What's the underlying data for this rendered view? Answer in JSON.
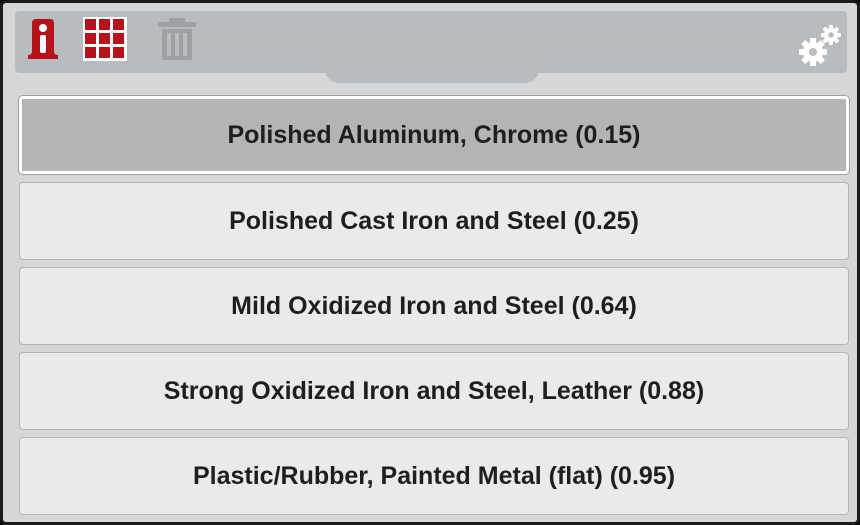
{
  "toolbar": {
    "icons": [
      "info-icon",
      "grid-icon",
      "trash-icon",
      "gear-icon"
    ],
    "colors": {
      "accent": "#b5121b",
      "disabled": "#9ea1a4",
      "gear": "#ffffff"
    }
  },
  "emissivity_list": {
    "selected_index": 0,
    "items": [
      {
        "label": "Polished Aluminum, Chrome (0.15)"
      },
      {
        "label": "Polished Cast Iron and Steel (0.25)"
      },
      {
        "label": "Mild Oxidized Iron and Steel (0.64)"
      },
      {
        "label": "Strong Oxidized Iron and Steel, Leather (0.88)"
      },
      {
        "label": "Plastic/Rubber, Painted Metal (flat) (0.95)"
      }
    ]
  }
}
